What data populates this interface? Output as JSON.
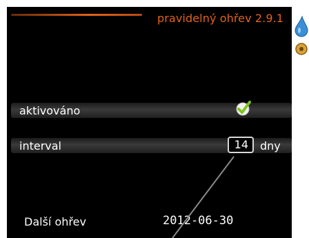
{
  "header": {
    "title": "pravidelný ohřev 2.9.1",
    "accent_color": "#e2631b"
  },
  "rows": {
    "activated": {
      "label": "aktivováno",
      "checked": true,
      "icon": "checkmark-icon"
    },
    "interval": {
      "label": "interval",
      "value": "14",
      "unit": "dny"
    }
  },
  "next_heating": {
    "label": "Další ohřev",
    "date": "2012-06-30"
  },
  "side_icons": [
    "water-drop-icon",
    "settings-icon"
  ]
}
